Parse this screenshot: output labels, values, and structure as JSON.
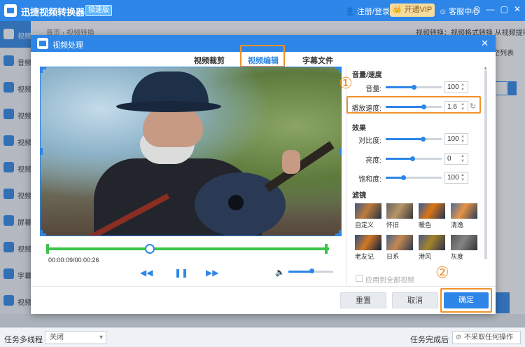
{
  "app": {
    "title": "迅捷视频转换器",
    "badge": "极速版",
    "user": "注册/登录",
    "vip": "开通VIP",
    "service": "客服中心",
    "controls": [
      "◎",
      "—",
      "▢",
      "✕"
    ]
  },
  "sidebar": {
    "items": [
      {
        "label": "视频转换",
        "active": true
      },
      {
        "label": "音频"
      },
      {
        "label": "视频"
      },
      {
        "label": "视频"
      },
      {
        "label": "视频"
      },
      {
        "label": "视频"
      },
      {
        "label": "视频"
      },
      {
        "label": "屏幕"
      },
      {
        "label": "视频"
      },
      {
        "label": "字幕"
      },
      {
        "label": "视频"
      }
    ]
  },
  "main": {
    "breadcrumb": "首页 › 视频转换",
    "hint": "视频转换：视频格式转换 从视频提取音频",
    "side_text": "空列表"
  },
  "status": {
    "threads_label": "任务多线程",
    "threads_value": "关闭",
    "done_label": "任务完成后",
    "done_value": "不采取任何操作"
  },
  "dialog": {
    "title": "视频处理",
    "close": "✕",
    "tabs": [
      "视频裁剪",
      "视频编辑",
      "字幕文件"
    ],
    "active_tab": 1,
    "time": "00:00:09/00:00:26",
    "playback": {
      "prev": "◀◀",
      "play": "❚❚",
      "next": "▶▶",
      "volume_icon": "🔈"
    },
    "progress": 0.36,
    "volume_level": 0.5,
    "sections": {
      "audio": "音量/速度",
      "effects": "效果",
      "filters": "滤镜"
    },
    "adjust": {
      "volume": {
        "label": "音量:",
        "value": "100",
        "level": 0.5
      },
      "speed": {
        "label": "播放速度:",
        "value": "1.6",
        "level": 0.8
      },
      "contrast": {
        "label": "对比度:",
        "value": "100",
        "level": 0.75
      },
      "brightness": {
        "label": "亮度:",
        "value": "0",
        "level": 0.5
      },
      "saturation": {
        "label": "饱和度:",
        "value": "100",
        "level": 0.35
      }
    },
    "filters": [
      {
        "label": "自定义"
      },
      {
        "label": "怀旧"
      },
      {
        "label": "暖色"
      },
      {
        "label": "清逸"
      },
      {
        "label": "老友记"
      },
      {
        "label": "日系"
      },
      {
        "label": "港风"
      },
      {
        "label": "灰度"
      }
    ],
    "apply_all": "应用到全部视频",
    "buttons": {
      "reset": "重置",
      "cancel": "取消",
      "confirm": "确定"
    },
    "markers": {
      "one": "①",
      "two": "②"
    }
  },
  "colors": {
    "accent": "#2d86e8",
    "highlight": "#f0922b",
    "timeline": "#3bc44a"
  }
}
